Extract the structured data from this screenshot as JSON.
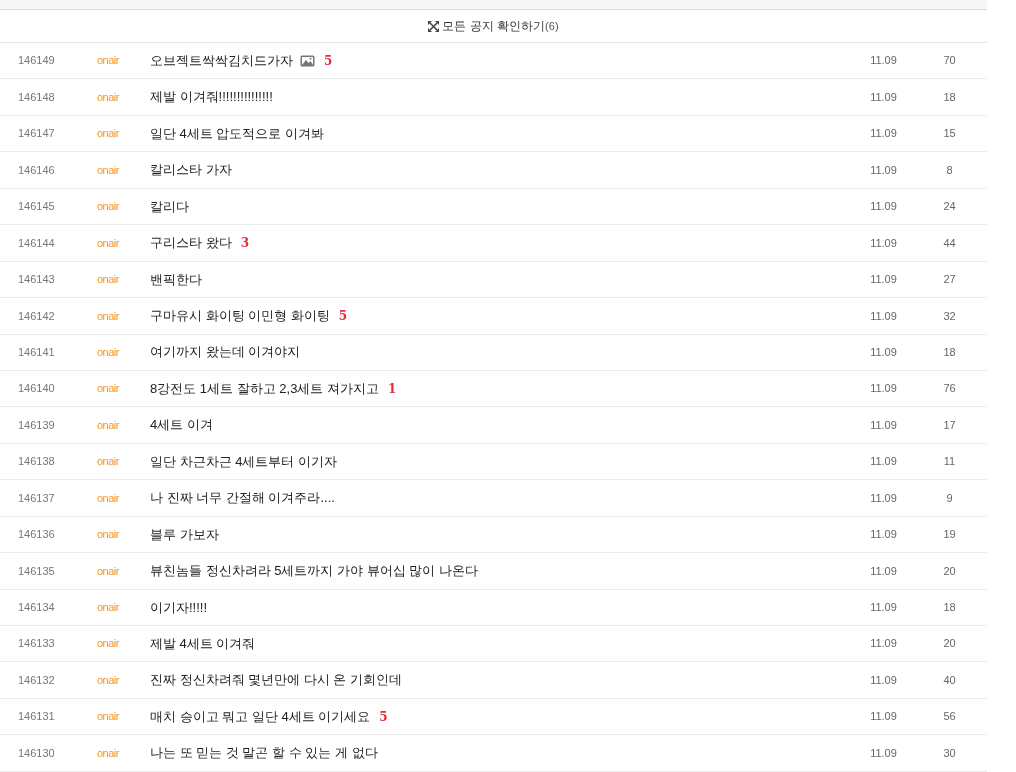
{
  "notice_toggle": {
    "label": "모든 공지 확인하기",
    "count": "(6)"
  },
  "posts": [
    {
      "number": "146149",
      "author": "onair",
      "title": "오브젝트싹싹김치드가자",
      "has_image": true,
      "comments": "5",
      "date": "11.09",
      "views": "70"
    },
    {
      "number": "146148",
      "author": "onair",
      "title": "제발 이겨줘!!!!!!!!!!!!!!!",
      "has_image": false,
      "date": "11.09",
      "views": "18"
    },
    {
      "number": "146147",
      "author": "onair",
      "title": "일단 4세트 압도적으로 이겨봐",
      "has_image": false,
      "date": "11.09",
      "views": "15"
    },
    {
      "number": "146146",
      "author": "onair",
      "title": "칼리스타 가자",
      "has_image": false,
      "date": "11.09",
      "views": "8"
    },
    {
      "number": "146145",
      "author": "onair",
      "title": "칼리다",
      "has_image": false,
      "date": "11.09",
      "views": "24"
    },
    {
      "number": "146144",
      "author": "onair",
      "title": "구리스타 왔다",
      "has_image": false,
      "comments": "3",
      "date": "11.09",
      "views": "44"
    },
    {
      "number": "146143",
      "author": "onair",
      "title": "밴픽한다",
      "has_image": false,
      "date": "11.09",
      "views": "27"
    },
    {
      "number": "146142",
      "author": "onair",
      "title": "구마유시 화이팅 이민형 화이팅",
      "has_image": false,
      "comments": "5",
      "date": "11.09",
      "views": "32"
    },
    {
      "number": "146141",
      "author": "onair",
      "title": "여기까지 왔는데 이겨야지",
      "has_image": false,
      "date": "11.09",
      "views": "18"
    },
    {
      "number": "146140",
      "author": "onair",
      "title": "8강전도 1세트 잘하고 2,3세트 져가지고",
      "has_image": false,
      "comments": "1",
      "date": "11.09",
      "views": "76"
    },
    {
      "number": "146139",
      "author": "onair",
      "title": "4세트 이겨",
      "has_image": false,
      "date": "11.09",
      "views": "17"
    },
    {
      "number": "146138",
      "author": "onair",
      "title": "일단 차근차근 4세트부터 이기자",
      "has_image": false,
      "date": "11.09",
      "views": "11"
    },
    {
      "number": "146137",
      "author": "onair",
      "title": "나 진짜 너무 간절해 이겨주라....",
      "has_image": false,
      "date": "11.09",
      "views": "9"
    },
    {
      "number": "146136",
      "author": "onair",
      "title": "블루 가보자",
      "has_image": false,
      "date": "11.09",
      "views": "19"
    },
    {
      "number": "146135",
      "author": "onair",
      "title": "뷰친놈들 정신차려라 5세트까지 가야 뷰어십 많이 나온다",
      "has_image": false,
      "date": "11.09",
      "views": "20"
    },
    {
      "number": "146134",
      "author": "onair",
      "title": "이기자!!!!!",
      "has_image": false,
      "date": "11.09",
      "views": "18"
    },
    {
      "number": "146133",
      "author": "onair",
      "title": "제발 4세트 이겨줘",
      "has_image": false,
      "date": "11.09",
      "views": "20"
    },
    {
      "number": "146132",
      "author": "onair",
      "title": "진짜 정신차려줘 몇년만에 다시 온 기회인데",
      "has_image": false,
      "date": "11.09",
      "views": "40"
    },
    {
      "number": "146131",
      "author": "onair",
      "title": "매치 승이고 뭐고 일단 4세트 이기세요",
      "has_image": false,
      "comments": "5",
      "date": "11.09",
      "views": "56"
    },
    {
      "number": "146130",
      "author": "onair",
      "title": "나는 또 믿는 것 말곤 할 수 있는 게 없다",
      "has_image": false,
      "date": "11.09",
      "views": "30"
    }
  ]
}
